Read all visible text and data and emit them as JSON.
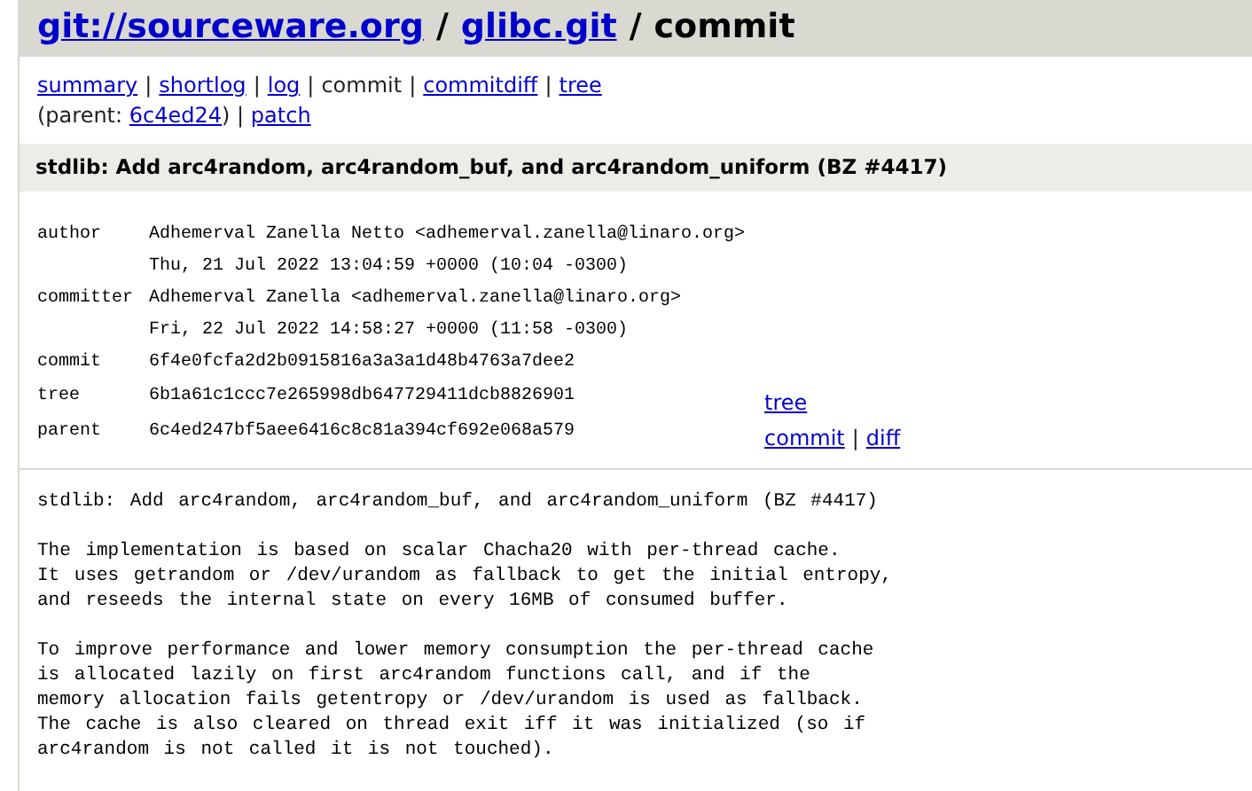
{
  "header": {
    "site": "git://sourceware.org",
    "separator_1": "/",
    "repo": "glibc.git",
    "separator_2": "/",
    "page": "commit"
  },
  "nav": {
    "items": [
      {
        "label": "summary",
        "selected": false
      },
      {
        "separator": "|",
        "label": "shortlog",
        "selected": false
      },
      {
        "separator": "|",
        "label": "log",
        "selected": false
      },
      {
        "separator": "|",
        "label": "commit",
        "selected": true
      },
      {
        "separator": "|",
        "label": "commitdiff",
        "selected": false
      },
      {
        "separator": "|",
        "label": "tree",
        "selected": false
      }
    ],
    "parent_prefix": "(parent:",
    "parent_link": "6c4ed24",
    "parent_suffix": ")",
    "patch_separator": "|",
    "patch": "patch"
  },
  "title": "stdlib: Add arc4random, arc4random_buf, and arc4random_uniform (BZ #4417)",
  "info": [
    {
      "label": "author",
      "value": "Adhemerval Zanella Netto <adhemerval.zanella@linaro.org>"
    },
    {
      "value": "Thu, 21 Jul 2022 13:04:59 +0000 (10:04 -0300)"
    },
    {
      "label": "committer",
      "value": "Adhemerval Zanella <adhemerval.zanella@linaro.org>"
    },
    {
      "value": "Fri, 22 Jul 2022 14:58:27 +0000 (11:58 -0300)"
    },
    {
      "label": "commit",
      "value": "6f4e0fcfa2d2b0915816a3a3a1d48b4763a7dee2"
    },
    {
      "label": "tree",
      "value": "6b1a61c1ccc7e265998db647729411dcb8826901",
      "links": [
        {
          "label": "tree"
        }
      ]
    },
    {
      "label": "parent",
      "value": "6c4ed247bf5aee6416c8c81a394cf692e068a579",
      "links": [
        {
          "label": "commit"
        },
        {
          "separator": "|",
          "label": "diff"
        }
      ]
    }
  ],
  "message": [
    [
      "stdlib: Add arc4random, arc4random_buf, and arc4random_uniform (BZ #4417)"
    ],
    [
      "The implementation is based on scalar Chacha20 with per-thread cache.",
      "It uses getrandom or /dev/urandom as fallback to get the initial entropy,",
      "and reseeds the internal state on every 16MB of consumed buffer."
    ],
    [
      "To improve performance and lower memory consumption the per-thread cache",
      "is allocated lazily on first arc4random functions call, and if the",
      "memory allocation fails getentropy or /dev/urandom is used as fallback.",
      "The cache is also cleared on thread exit iff it was initialized (so if",
      "arc4random is not called it is not touched)."
    ]
  ]
}
